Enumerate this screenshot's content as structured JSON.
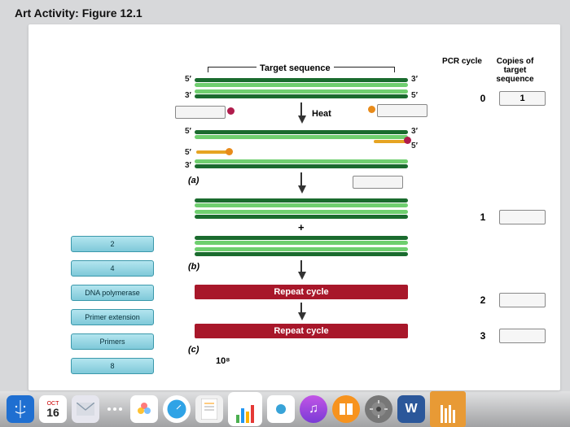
{
  "title": "Art Activity: Figure 12.1",
  "headers": {
    "col1": "PCR cycle",
    "col2": "Copies of target sequence"
  },
  "diagram": {
    "target_label": "Target sequence",
    "heat_label": "Heat",
    "steps": {
      "a": "(a)",
      "b": "(b)",
      "c": "(c)"
    },
    "repeat": "Repeat cycle",
    "plus": "+",
    "exponent": "10⁸",
    "ends": {
      "five": "5′",
      "three": "3′"
    }
  },
  "cycle_rows": [
    {
      "cycle": "0",
      "copies": "1",
      "copies_filled": true
    },
    {
      "cycle": "1",
      "copies": "",
      "copies_filled": false
    },
    {
      "cycle": "2",
      "copies": "",
      "copies_filled": false
    },
    {
      "cycle": "3",
      "copies": "",
      "copies_filled": false
    }
  ],
  "drag_labels": [
    "2",
    "4",
    "DNA polymerase",
    "Primer extension",
    "Primers",
    "8"
  ],
  "dock": {
    "cal_month": "OCT",
    "cal_day": "16",
    "word": "W"
  }
}
